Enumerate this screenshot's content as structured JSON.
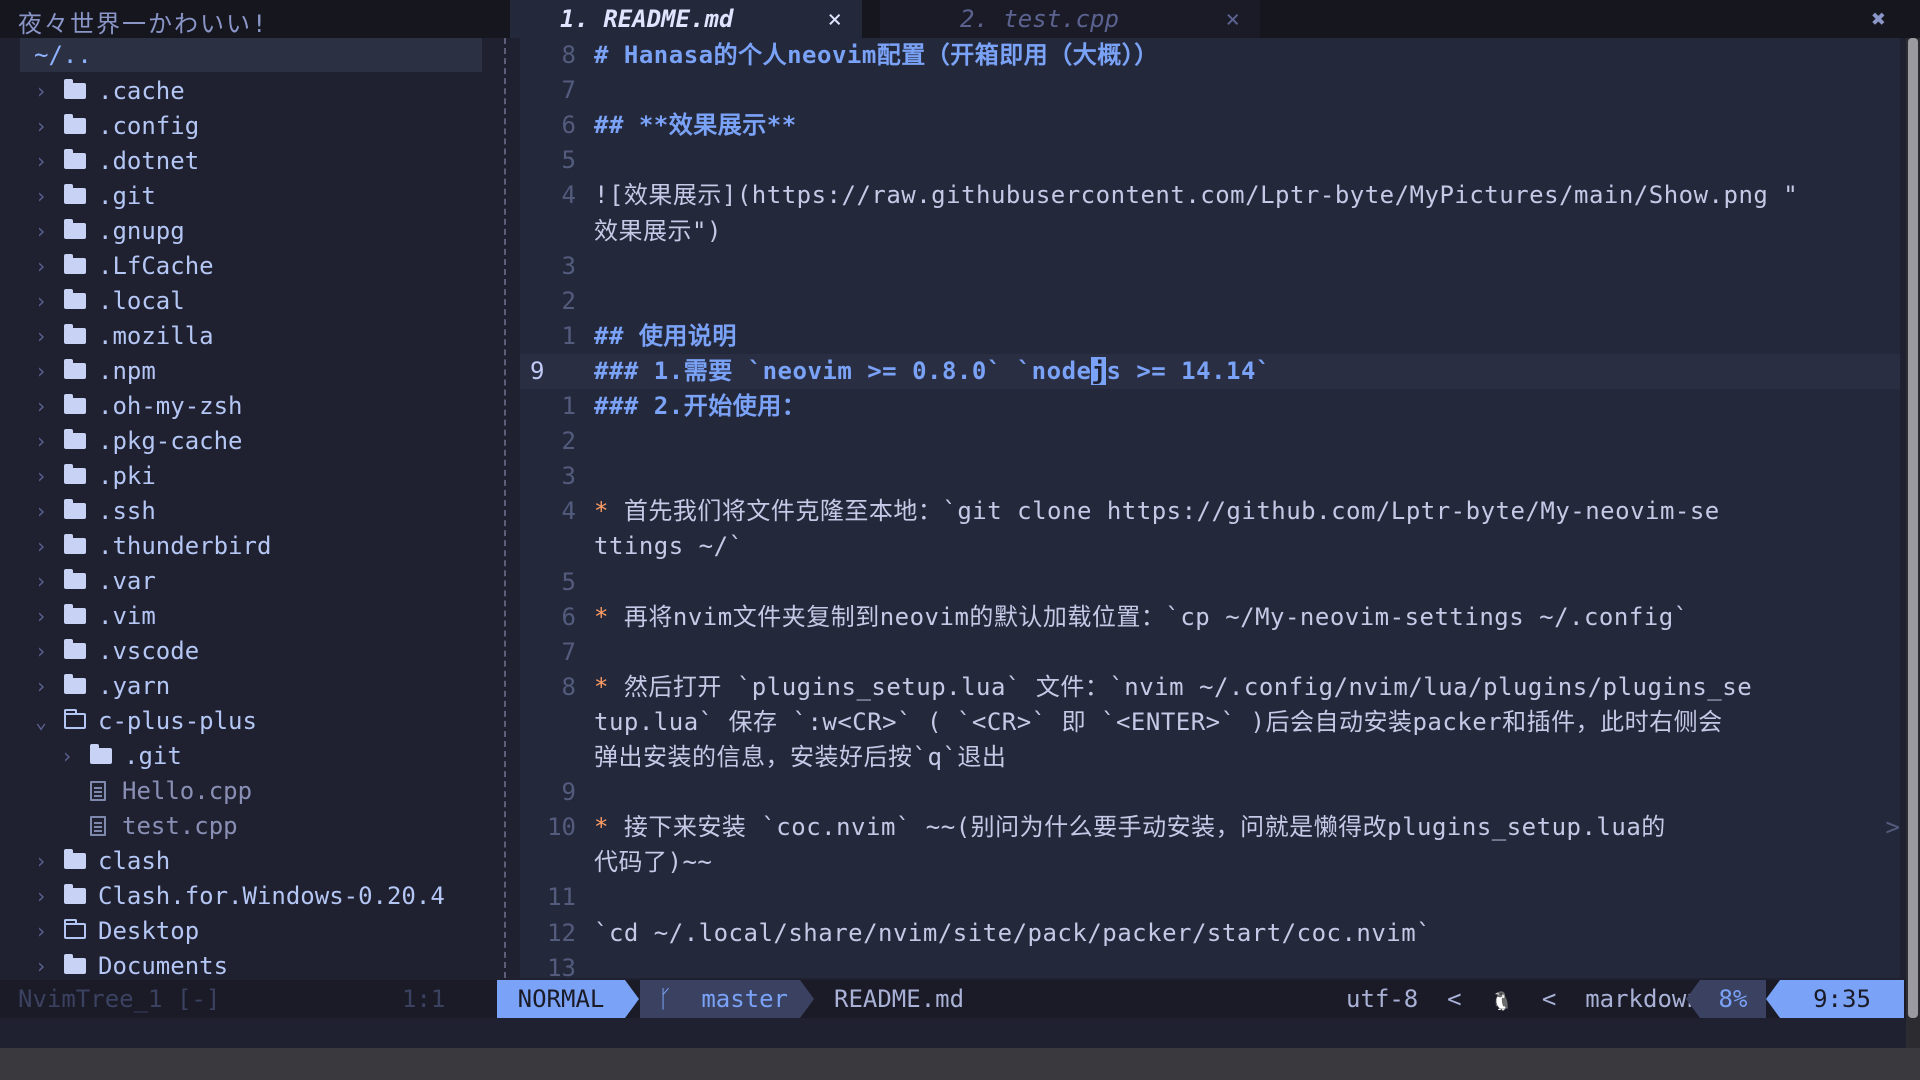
{
  "tree": {
    "title": "夜々世界一かわいい!",
    "root": "~/..",
    "items": [
      {
        "name": ".cache",
        "depth": 0,
        "kind": "dir",
        "open": false
      },
      {
        "name": ".config",
        "depth": 0,
        "kind": "dir",
        "open": false
      },
      {
        "name": ".dotnet",
        "depth": 0,
        "kind": "dir",
        "open": false
      },
      {
        "name": ".git",
        "depth": 0,
        "kind": "dir",
        "open": false
      },
      {
        "name": ".gnupg",
        "depth": 0,
        "kind": "dir",
        "open": false
      },
      {
        "name": ".LfCache",
        "depth": 0,
        "kind": "dir",
        "open": false
      },
      {
        "name": ".local",
        "depth": 0,
        "kind": "dir",
        "open": false
      },
      {
        "name": ".mozilla",
        "depth": 0,
        "kind": "dir",
        "open": false
      },
      {
        "name": ".npm",
        "depth": 0,
        "kind": "dir",
        "open": false
      },
      {
        "name": ".oh-my-zsh",
        "depth": 0,
        "kind": "dir",
        "open": false
      },
      {
        "name": ".pkg-cache",
        "depth": 0,
        "kind": "dir",
        "open": false
      },
      {
        "name": ".pki",
        "depth": 0,
        "kind": "dir",
        "open": false
      },
      {
        "name": ".ssh",
        "depth": 0,
        "kind": "dir",
        "open": false
      },
      {
        "name": ".thunderbird",
        "depth": 0,
        "kind": "dir",
        "open": false
      },
      {
        "name": ".var",
        "depth": 0,
        "kind": "dir",
        "open": false
      },
      {
        "name": ".vim",
        "depth": 0,
        "kind": "dir",
        "open": false
      },
      {
        "name": ".vscode",
        "depth": 0,
        "kind": "dir",
        "open": false
      },
      {
        "name": ".yarn",
        "depth": 0,
        "kind": "dir",
        "open": false
      },
      {
        "name": "c-plus-plus",
        "depth": 0,
        "kind": "dir",
        "open": true
      },
      {
        "name": ".git",
        "depth": 1,
        "kind": "dir",
        "open": false
      },
      {
        "name": "Hello.cpp",
        "depth": 1,
        "kind": "file"
      },
      {
        "name": "test.cpp",
        "depth": 1,
        "kind": "file"
      },
      {
        "name": "clash",
        "depth": 0,
        "kind": "dir",
        "open": false
      },
      {
        "name": "Clash.for.Windows-0.20.4",
        "depth": 0,
        "kind": "dir",
        "open": false
      },
      {
        "name": "Desktop",
        "depth": 0,
        "kind": "dir-outline",
        "open": false
      },
      {
        "name": "Documents",
        "depth": 0,
        "kind": "dir",
        "open": false
      }
    ]
  },
  "tabs": [
    {
      "label": "1. README.md",
      "active": true,
      "close": "×"
    },
    {
      "label": "2. test.cpp",
      "active": false,
      "close": "×"
    }
  ],
  "window_close": "✖",
  "icons": {
    "chevron_right": "›",
    "chevron_down": "⌄",
    "branch": "ᚴ"
  },
  "editor": {
    "lines": [
      {
        "n": "8",
        "segs": [
          {
            "t": "# Hanasa的个人neovim配置（开箱即用（大概））",
            "c": "h1"
          }
        ]
      },
      {
        "n": "7",
        "segs": []
      },
      {
        "n": "6",
        "segs": [
          {
            "t": "##  **效果展示**",
            "c": "h2"
          }
        ]
      },
      {
        "n": "5",
        "segs": []
      },
      {
        "n": "4",
        "segs": [
          {
            "t": "![效果展示](https://raw.githubusercontent.com/Lptr-byte/MyPictures/main/Show.png \"",
            "c": ""
          }
        ]
      },
      {
        "n": "",
        "segs": [
          {
            "t": "效果展示\")",
            "c": ""
          }
        ]
      },
      {
        "n": "3",
        "segs": []
      },
      {
        "n": "2",
        "segs": []
      },
      {
        "n": "1",
        "segs": [
          {
            "t": "## 使用说明",
            "c": "h2"
          }
        ]
      },
      {
        "n": "9",
        "current": true,
        "segs": [
          {
            "t": "### 1.需要 `neovim >= 0.8.0` `node",
            "c": "h2"
          },
          {
            "t": "j",
            "c": "h2 cursor"
          },
          {
            "t": "s >= 14.14`",
            "c": "h2"
          }
        ]
      },
      {
        "n": "1",
        "segs": [
          {
            "t": "### 2.开始使用：",
            "c": "h2"
          }
        ]
      },
      {
        "n": "2",
        "segs": []
      },
      {
        "n": "3",
        "segs": []
      },
      {
        "n": "4",
        "segs": [
          {
            "t": "*",
            "c": "bullet"
          },
          {
            "t": "   首先我们将文件克隆至本地：`git clone https://github.com/Lptr-byte/My-neovim-se",
            "c": ""
          }
        ]
      },
      {
        "n": "",
        "segs": [
          {
            "t": "ttings ~/`",
            "c": ""
          }
        ]
      },
      {
        "n": "5",
        "segs": []
      },
      {
        "n": "6",
        "segs": [
          {
            "t": "*",
            "c": "bullet"
          },
          {
            "t": "   再将nvim文件夹复制到neovim的默认加载位置：`cp ~/My-neovim-settings ~/.config`",
            "c": ""
          }
        ]
      },
      {
        "n": "7",
        "segs": []
      },
      {
        "n": "8",
        "segs": [
          {
            "t": "*",
            "c": "bullet"
          },
          {
            "t": "   然后打开 `plugins_setup.lua` 文件：`nvim ~/.config/nvim/lua/plugins/plugins_se",
            "c": ""
          }
        ]
      },
      {
        "n": "",
        "segs": [
          {
            "t": "tup.lua` 保存 `:w<CR>` ( `<CR>` 即 `<ENTER>` )后会自动安装packer和插件，此时右侧会",
            "c": ""
          }
        ]
      },
      {
        "n": "",
        "segs": [
          {
            "t": "弹出安装的信息，安装好后按`q`退出",
            "c": ""
          }
        ]
      },
      {
        "n": "9",
        "segs": []
      },
      {
        "n": "10",
        "overflow": ">",
        "segs": [
          {
            "t": "*",
            "c": "bullet"
          },
          {
            "t": "  接下来安装 `coc.nvim` ~~(别问为什么要手动安装，问就是懒得改plugins_setup.lua的",
            "c": ""
          }
        ]
      },
      {
        "n": "",
        "segs": [
          {
            "t": "代码了)~~",
            "c": ""
          }
        ]
      },
      {
        "n": "11",
        "segs": []
      },
      {
        "n": "12",
        "segs": [
          {
            "t": "   `cd ~/.local/share/nvim/site/pack/packer/start/coc.nvim`",
            "c": ""
          }
        ]
      },
      {
        "n": "13",
        "segs": []
      }
    ]
  },
  "status": {
    "tree_name": "NvimTree_1 [-]",
    "tree_pos": "1:1",
    "mode": "NORMAL",
    "branch": "master",
    "file": "README.md",
    "encoding": "utf-8",
    "os_icon": "🐧",
    "filetype": "markdown",
    "percent": "8%",
    "position": "9:35"
  },
  "colors": {
    "background": "#24283b",
    "accent": "#7aa2f7",
    "bullet": "#ff9e64"
  }
}
